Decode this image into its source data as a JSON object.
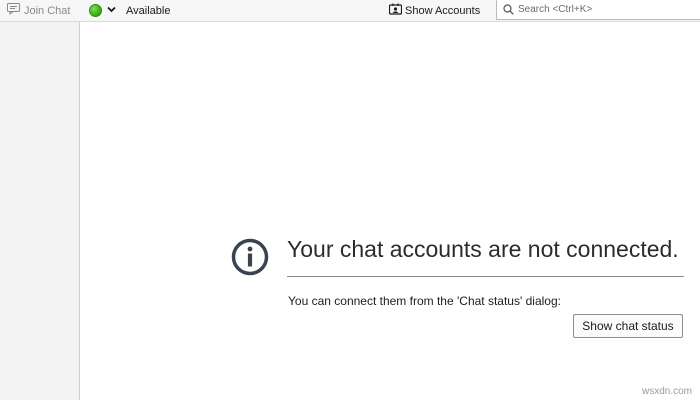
{
  "toolbar": {
    "join_chat_label": "Join Chat",
    "status_label": "Available",
    "status_color": "#3fb31c",
    "show_accounts_label": "Show Accounts",
    "search_placeholder": "Search <Ctrl+K>",
    "search_value": ""
  },
  "notice": {
    "title": "Your chat accounts are not connected.",
    "description": "You can connect them from the 'Chat status' dialog:",
    "button_label": "Show chat status",
    "icon": "info-icon"
  },
  "watermark": "wsxdn.com",
  "icons": {
    "join_chat": "chat-bubble-icon",
    "status": "green-dot-icon",
    "dropdown": "chevron-down-icon",
    "accounts": "accounts-icon",
    "search": "search-icon"
  }
}
